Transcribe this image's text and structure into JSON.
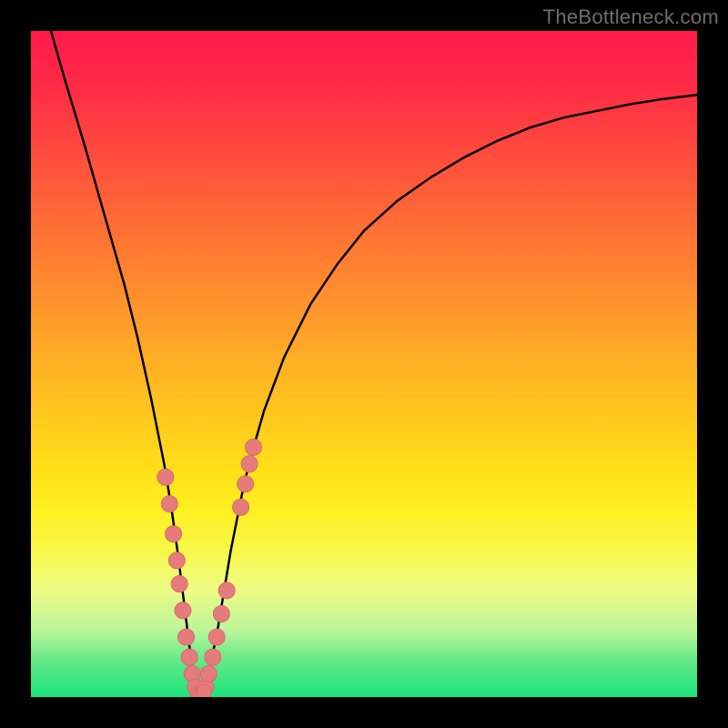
{
  "watermark": "TheBottleneck.com",
  "colors": {
    "frame": "#000000",
    "curve": "#000000",
    "marker_fill": "#e67b7b",
    "marker_stroke": "#d86b6b",
    "gradient_stops": [
      "#ff1a4a",
      "#ff6a36",
      "#ffc81e",
      "#f8f84a",
      "#5de886",
      "#19e57e"
    ]
  },
  "chart_data": {
    "type": "line",
    "title": "",
    "xlabel": "",
    "ylabel": "",
    "xlim": [
      0,
      100
    ],
    "ylim": [
      0,
      100
    ],
    "curve": {
      "x": [
        3,
        5,
        8,
        10,
        12,
        14,
        16,
        18,
        19,
        20,
        21,
        22,
        23,
        23.5,
        24,
        24.5,
        25,
        25.5,
        26,
        27,
        28,
        29,
        30,
        31,
        32,
        33,
        35,
        38,
        42,
        46,
        50,
        55,
        60,
        65,
        70,
        75,
        80,
        85,
        90,
        95,
        100
      ],
      "y": [
        100,
        93,
        83,
        76,
        69,
        62,
        54,
        45,
        40,
        35,
        29,
        22,
        14,
        10,
        6,
        3,
        1,
        0.5,
        1,
        5,
        10,
        16,
        22,
        27,
        32,
        36,
        43,
        51,
        59,
        65,
        70,
        74.5,
        78,
        81,
        83.5,
        85.5,
        87,
        88,
        89,
        89.8,
        90.4
      ]
    },
    "markers_left": {
      "x": [
        20.2,
        20.8,
        21.4,
        21.9,
        22.3,
        22.8,
        23.3,
        23.8,
        24.2,
        24.7
      ],
      "y": [
        33,
        29,
        24.5,
        20.5,
        17,
        13,
        9,
        6,
        3.5,
        1.5
      ]
    },
    "markers_right": {
      "x": [
        26.2,
        26.7,
        27.3,
        27.9,
        28.6,
        29.4,
        31.5,
        32.2,
        32.8,
        33.4
      ],
      "y": [
        1.5,
        3.5,
        6,
        9,
        12.5,
        16,
        28.5,
        32,
        35,
        37.5
      ]
    },
    "markers_bottom": {
      "x": [
        25.0,
        25.3,
        25.7,
        26.0
      ],
      "y": [
        0.5,
        0.3,
        0.4,
        0.8
      ]
    }
  }
}
